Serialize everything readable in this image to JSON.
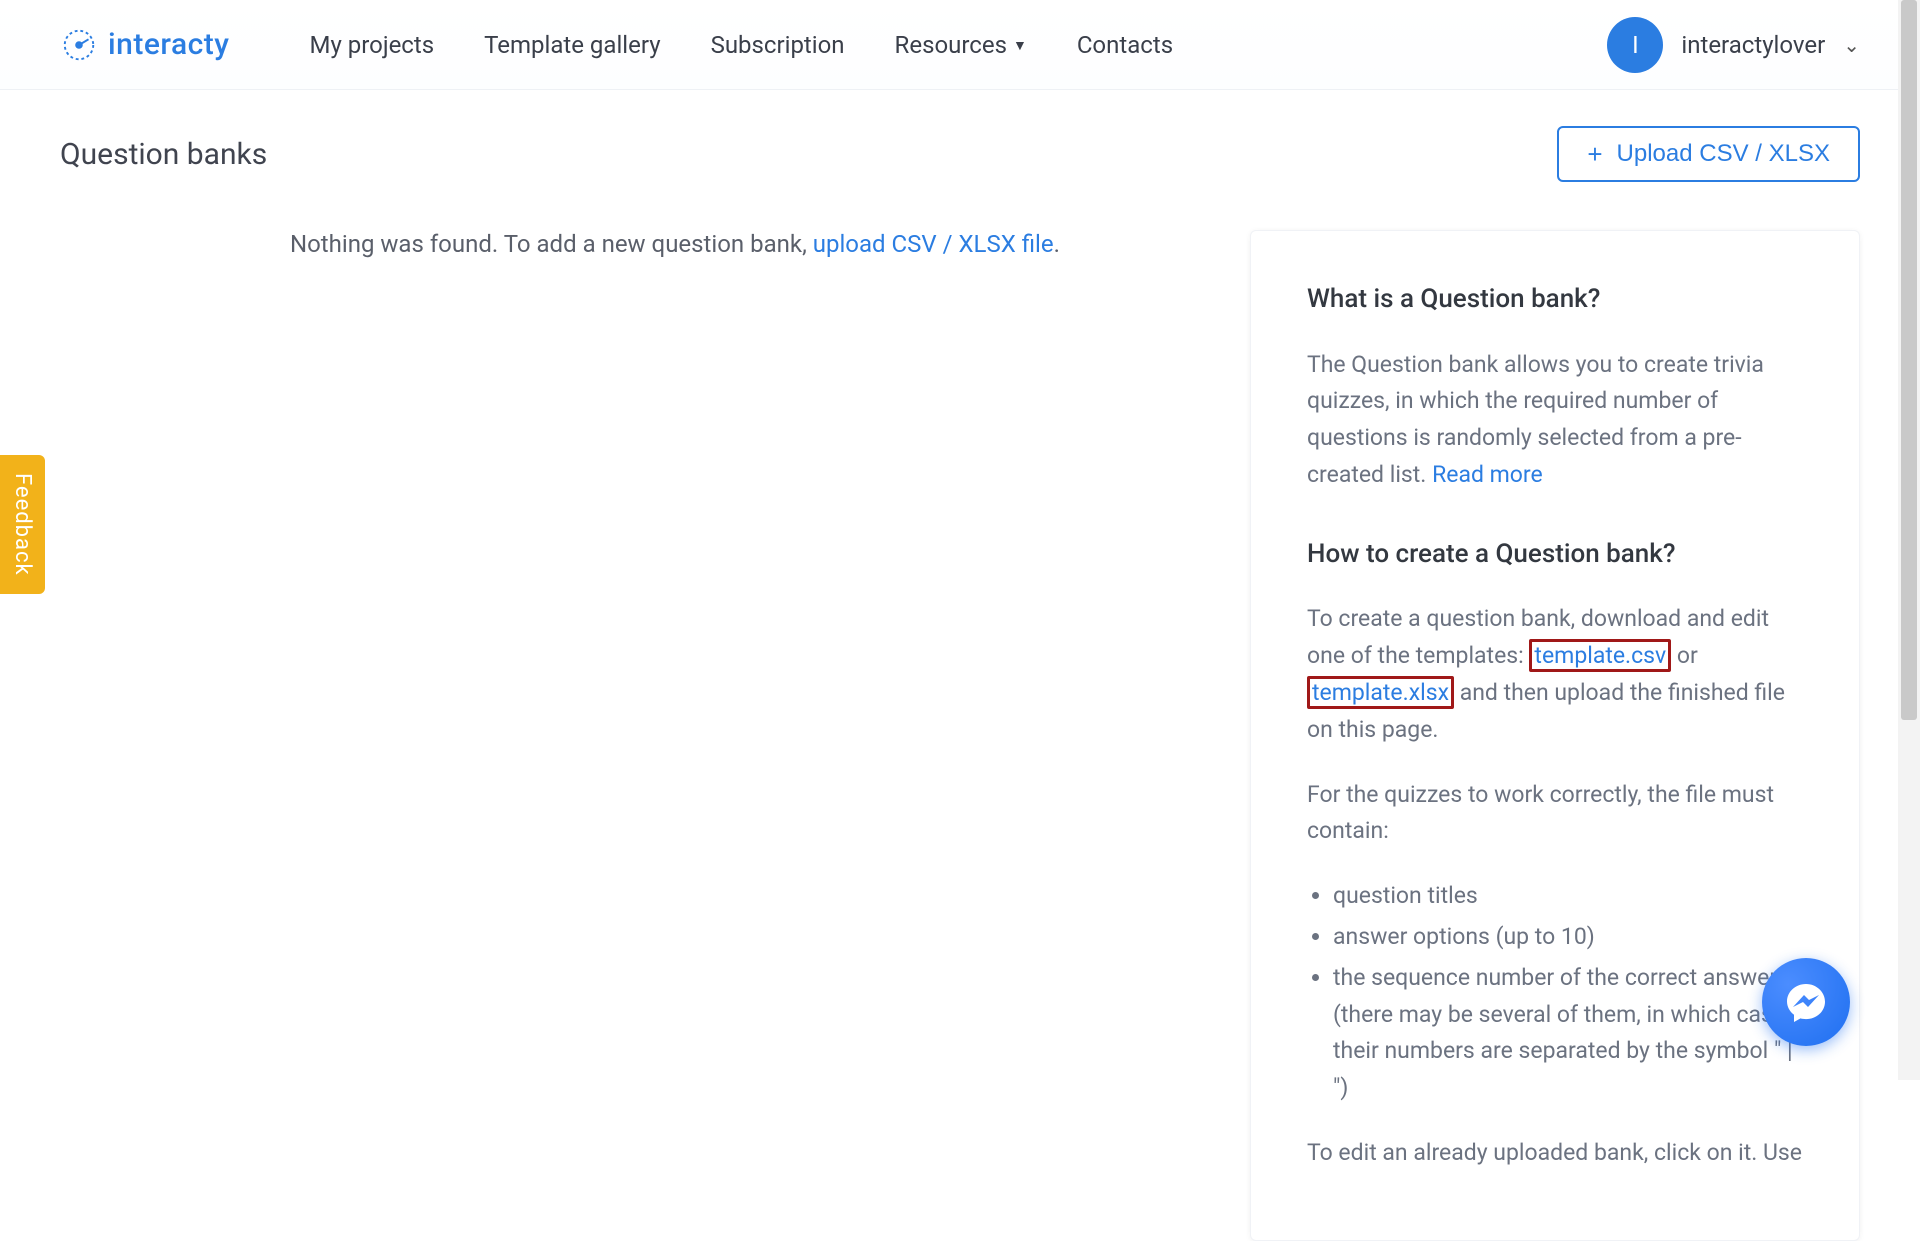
{
  "brand": {
    "name": "interacty"
  },
  "nav": {
    "projects": "My projects",
    "templates": "Template gallery",
    "subscription": "Subscription",
    "resources": "Resources",
    "contacts": "Contacts"
  },
  "user": {
    "initial": "I",
    "name": "interactylover"
  },
  "page": {
    "title": "Question banks",
    "upload_btn": "Upload CSV / XLSX"
  },
  "empty": {
    "prefix": "Nothing was found. To add a new question bank, ",
    "link": "upload CSV / XLSX file",
    "suffix": "."
  },
  "info": {
    "h1": "What is a Question bank?",
    "p1": "The Question bank allows you to create trivia quizzes, in which the required number of questions is randomly selected from a pre-created list. ",
    "read_more": "Read more",
    "h2": "How to create a Question bank?",
    "p2_a": "To create a question bank, download and edit one of the templates: ",
    "tmpl_csv": "template.csv",
    "p2_or": " or ",
    "tmpl_xlsx": "template.xlsx",
    "p2_b": " and then upload the finished file on this page.",
    "p3": "For the quizzes to work correctly, the file must contain:",
    "bullets": [
      "question titles",
      "answer options (up to 10)",
      "the sequence number of the correct answer (there may be several of them, in which case their numbers are separated by the symbol \" | \")"
    ],
    "p4": "To edit an already uploaded bank, click on it. Use"
  },
  "feedback": "Feedback"
}
